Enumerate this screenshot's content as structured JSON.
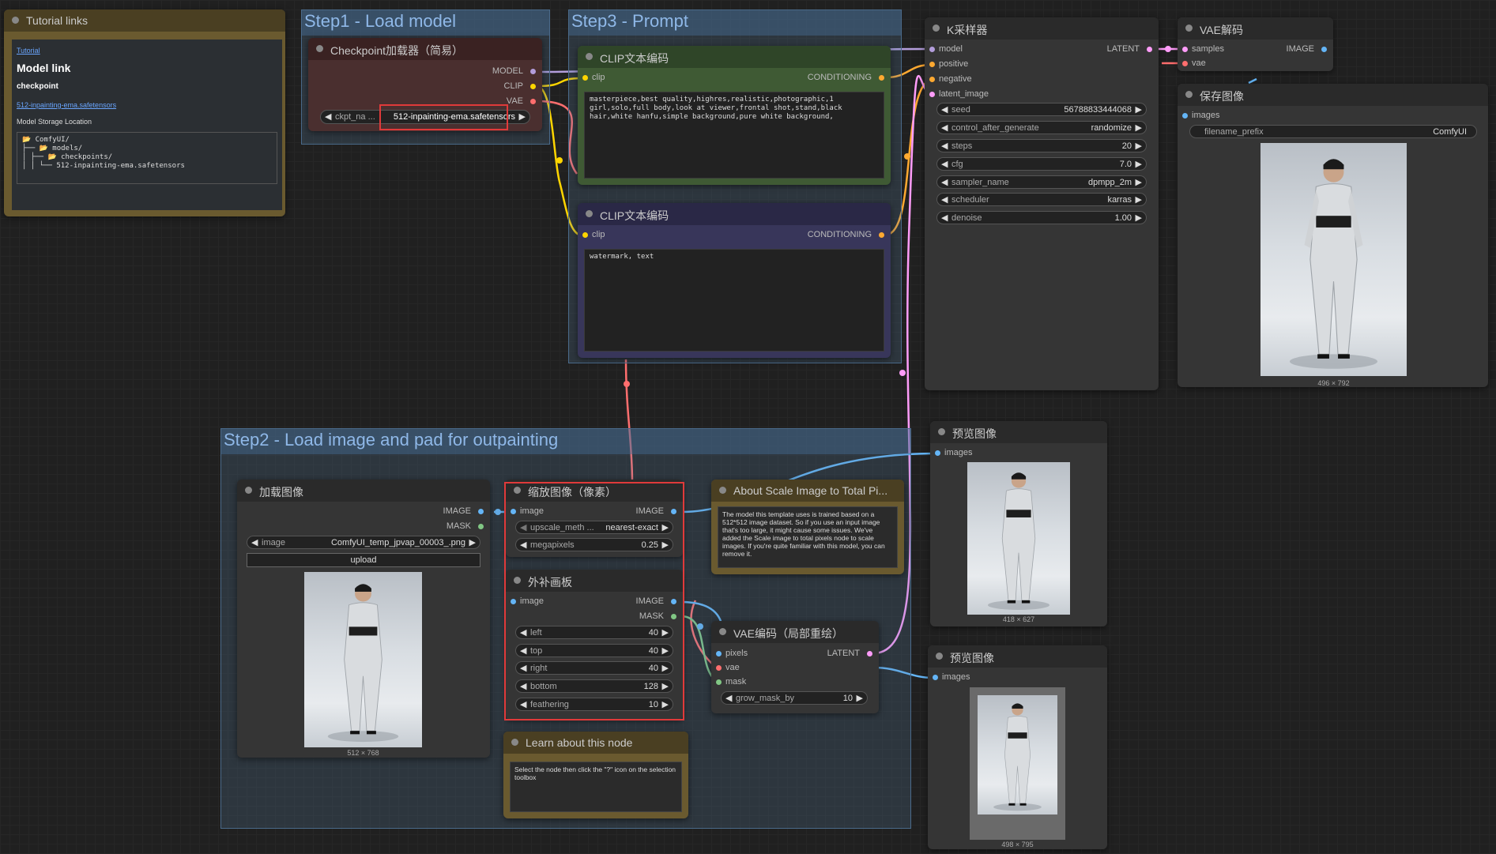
{
  "colors": {
    "model": "#b39ddb",
    "clip": "#ffd500",
    "vae": "#ff6e6e",
    "conditioning": "#ffa931",
    "latent": "#ff9cf9",
    "image": "#64b5f6",
    "mask": "#81c784"
  },
  "groups": {
    "step1": "Step1 - Load model",
    "step2": "Step2 - Load image and pad for outpainting",
    "step3": "Step3 - Prompt"
  },
  "tutorial": {
    "title": "Tutorial links",
    "link1": "Tutorial",
    "heading": "Model link",
    "subheading": "checkpoint",
    "model_link": "512-inpainting-ema.safetensors",
    "storage_label": "Model Storage Location",
    "tree": [
      "📂 ComfyUI/",
      "├── 📂 models/",
      "│   ├── 📂 checkpoints/",
      "│   │   └── 512-inpainting-ema.safetensors"
    ]
  },
  "checkpoint": {
    "title": "Checkpoint加载器（简易）",
    "out_model": "MODEL",
    "out_clip": "CLIP",
    "out_vae": "VAE",
    "ckpt_label": "ckpt_na ...",
    "ckpt_value": "512-inpainting-ema.safetensors"
  },
  "clip_pos": {
    "title": "CLIP文本编码",
    "in_clip": "clip",
    "out": "CONDITIONING",
    "text": "masterpiece,best quality,highres,realistic,photographic,1\ngirl,solo,full body,look at viewer,frontal shot,stand,black\nhair,white hanfu,simple background,pure white background,"
  },
  "clip_neg": {
    "title": "CLIP文本编码",
    "in_clip": "clip",
    "out": "CONDITIONING",
    "text": "watermark, text"
  },
  "ksampler": {
    "title": "K采样器",
    "inputs": [
      "model",
      "positive",
      "negative",
      "latent_image"
    ],
    "out": "LATENT",
    "widgets": [
      {
        "label": "seed",
        "value": "56788833444068"
      },
      {
        "label": "control_after_generate",
        "value": "randomize"
      },
      {
        "label": "steps",
        "value": "20"
      },
      {
        "label": "cfg",
        "value": "7.0"
      },
      {
        "label": "sampler_name",
        "value": "dpmpp_2m"
      },
      {
        "label": "scheduler",
        "value": "karras"
      },
      {
        "label": "denoise",
        "value": "1.00"
      }
    ]
  },
  "vae_decode": {
    "title": "VAE解码",
    "in_samples": "samples",
    "in_vae": "vae",
    "out": "IMAGE"
  },
  "save_image": {
    "title": "保存图像",
    "in_images": "images",
    "prefix_label": "filename_prefix",
    "prefix_value": "ComfyUI",
    "size": "496 × 792"
  },
  "load_image": {
    "title": "加载图像",
    "out_image": "IMAGE",
    "out_mask": "MASK",
    "image_label": "image",
    "image_value": "ComfyUI_temp_jpvap_00003_.png",
    "upload": "upload",
    "size": "512 × 768"
  },
  "scale": {
    "title": "缩放图像（像素）",
    "in_image": "image",
    "out": "IMAGE",
    "method_label": "upscale_meth ...",
    "method_value": "nearest-exact",
    "mp_label": "megapixels",
    "mp_value": "0.25"
  },
  "pad": {
    "title": "外补画板",
    "in_image": "image",
    "out_image": "IMAGE",
    "out_mask": "MASK",
    "widgets": [
      {
        "label": "left",
        "value": "40"
      },
      {
        "label": "top",
        "value": "40"
      },
      {
        "label": "right",
        "value": "40"
      },
      {
        "label": "bottom",
        "value": "128"
      },
      {
        "label": "feathering",
        "value": "10"
      }
    ]
  },
  "about_note": {
    "title": "About Scale Image to Total Pi...",
    "text": "The model this template uses is trained based on a 512*512 image dataset. So if you use an input image that's too large, it might cause some issues. We've added the Scale image to total pixels node to scale images. If you're quite familiar with this model, you can remove it."
  },
  "learn_note": {
    "title": "Learn about this node",
    "text": "Select the node then click the \"?\" icon on the selection toolbox"
  },
  "vae_encode": {
    "title": "VAE编码（局部重绘）",
    "in_pixels": "pixels",
    "in_vae": "vae",
    "in_mask": "mask",
    "out": "LATENT",
    "grow_label": "grow_mask_by",
    "grow_value": "10"
  },
  "preview1": {
    "title": "预览图像",
    "in_images": "images",
    "size": "418 × 627"
  },
  "preview2": {
    "title": "预览图像",
    "in_images": "images",
    "size": "498 × 795"
  }
}
